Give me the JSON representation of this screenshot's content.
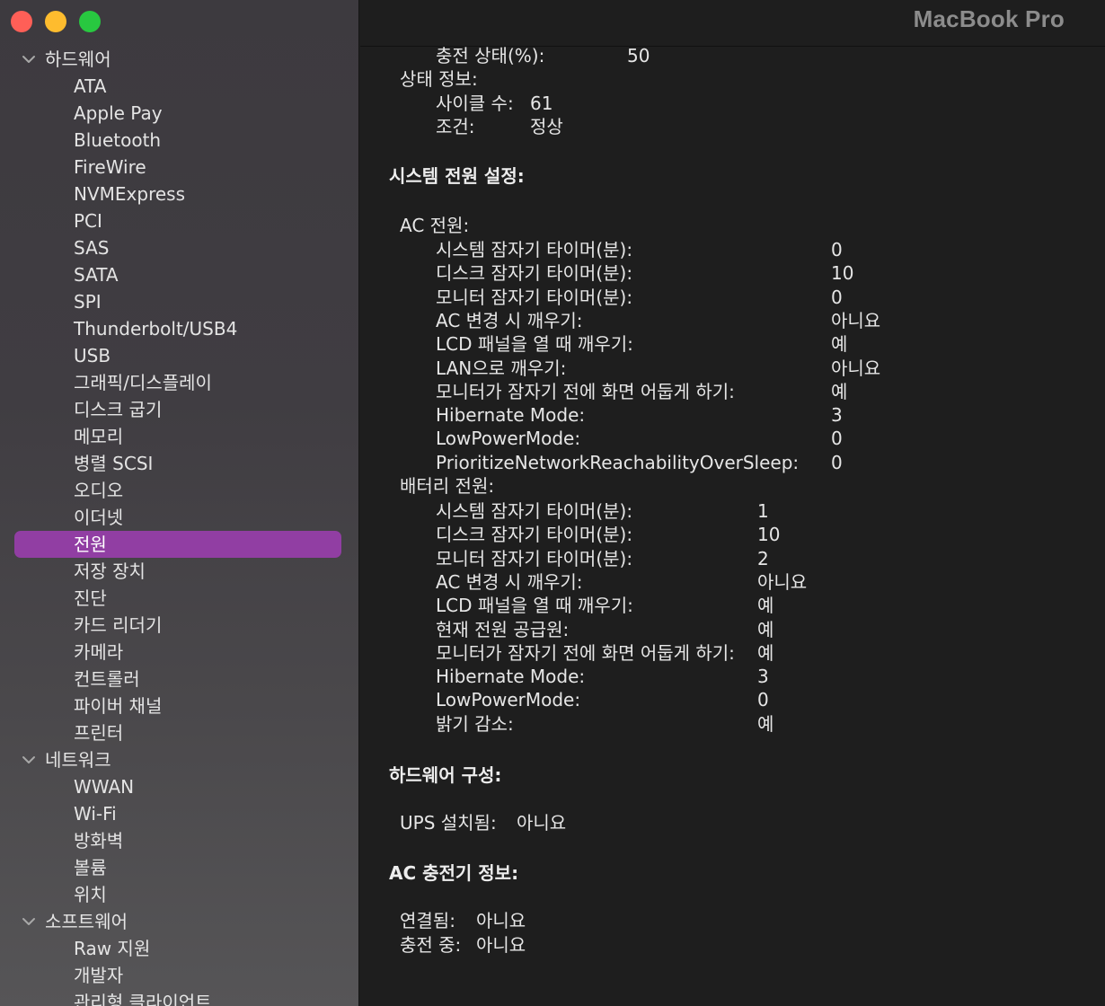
{
  "window": {
    "title": "MacBook Pro"
  },
  "sidebar": {
    "groups": [
      {
        "label": "하드웨어",
        "items": [
          "ATA",
          "Apple Pay",
          "Bluetooth",
          "FireWire",
          "NVMExpress",
          "PCI",
          "SAS",
          "SATA",
          "SPI",
          "Thunderbolt/USB4",
          "USB",
          "그래픽/디스플레이",
          "디스크 굽기",
          "메모리",
          "병렬 SCSI",
          "오디오",
          "이더넷",
          "전원",
          "저장 장치",
          "진단",
          "카드 리더기",
          "카메라",
          "컨트롤러",
          "파이버 채널",
          "프린터"
        ]
      },
      {
        "label": "네트워크",
        "items": [
          "WWAN",
          "Wi-Fi",
          "방화벽",
          "볼륨",
          "위치"
        ]
      },
      {
        "label": "소프트웨어",
        "items": [
          "Raw 지원",
          "개발자",
          "관리형 클라이언트"
        ]
      }
    ],
    "selected_item": "전원"
  },
  "main": {
    "battery_top": {
      "charge_label": "충전 상태(%):",
      "charge_value": "50",
      "health_title": "상태 정보:",
      "cycle_label": "사이클 수:",
      "cycle_value": "61",
      "condition_label": "조건:",
      "condition_value": "정상"
    },
    "system_power": {
      "heading": "시스템 전원 설정:",
      "ac": {
        "title": "AC 전원:",
        "rows": [
          {
            "label": "시스템 잠자기 타이머(분):",
            "value": "0"
          },
          {
            "label": "디스크 잠자기 타이머(분):",
            "value": "10"
          },
          {
            "label": "모니터 잠자기 타이머(분):",
            "value": "0"
          },
          {
            "label": "AC 변경 시 깨우기:",
            "value": "아니요"
          },
          {
            "label": "LCD 패널을 열 때 깨우기:",
            "value": "예"
          },
          {
            "label": "LAN으로 깨우기:",
            "value": "아니요"
          },
          {
            "label": "모니터가 잠자기 전에 화면 어둡게 하기:",
            "value": "예"
          },
          {
            "label": "Hibernate Mode:",
            "value": "3"
          },
          {
            "label": "LowPowerMode:",
            "value": "0"
          },
          {
            "label": "PrioritizeNetworkReachabilityOverSleep:",
            "value": "0"
          }
        ]
      },
      "battery": {
        "title": "배터리 전원:",
        "rows": [
          {
            "label": "시스템 잠자기 타이머(분):",
            "value": "1"
          },
          {
            "label": "디스크 잠자기 타이머(분):",
            "value": "10"
          },
          {
            "label": "모니터 잠자기 타이머(분):",
            "value": "2"
          },
          {
            "label": "AC 변경 시 깨우기:",
            "value": "아니요"
          },
          {
            "label": "LCD 패널을 열 때 깨우기:",
            "value": "예"
          },
          {
            "label": "현재 전원 공급원:",
            "value": "예"
          },
          {
            "label": "모니터가 잠자기 전에 화면 어둡게 하기:",
            "value": "예"
          },
          {
            "label": "Hibernate Mode:",
            "value": "3"
          },
          {
            "label": "LowPowerMode:",
            "value": "0"
          },
          {
            "label": "밝기 감소:",
            "value": "예"
          }
        ]
      }
    },
    "hardware_config": {
      "heading": "하드웨어 구성:",
      "ups_label": "UPS 설치됨:",
      "ups_value": "아니요"
    },
    "ac_charger": {
      "heading": "AC 충전기 정보:",
      "connected_label": "연결됨:",
      "connected_value": "아니요",
      "charging_label": "충전 중:",
      "charging_value": "아니요"
    }
  }
}
